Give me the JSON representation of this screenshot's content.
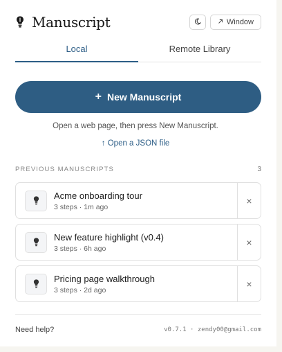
{
  "header": {
    "title": "Manuscript",
    "logo_icon": "bulb-icon",
    "theme_icon": "moon-icon",
    "window_icon": "arrow-up-right-icon",
    "window_label": "Window"
  },
  "tabs": [
    {
      "label": "Local",
      "active": true
    },
    {
      "label": "Remote Library",
      "active": false
    }
  ],
  "new_button": {
    "icon": "+",
    "label": "New Manuscript"
  },
  "hint": "Open a web page, then press New Manuscript.",
  "json_link": {
    "icon": "↑",
    "label": "Open a JSON file"
  },
  "previous": {
    "heading": "PREVIOUS MANUSCRIPTS",
    "count": "3",
    "items": [
      {
        "title": "Acme onboarding tour",
        "meta": "3 steps · 1m ago"
      },
      {
        "title": "New feature highlight (v0.4)",
        "meta": "3 steps · 6h ago"
      },
      {
        "title": "Pricing page walkthrough",
        "meta": "3 steps · 2d ago"
      }
    ],
    "delete_glyph": "×"
  },
  "footer": {
    "help": "Need help?",
    "version": "v0.7.1 · zendy00@gmail.com"
  },
  "colors": {
    "accent": "#2e5d83",
    "background": "#f6f5f0"
  }
}
